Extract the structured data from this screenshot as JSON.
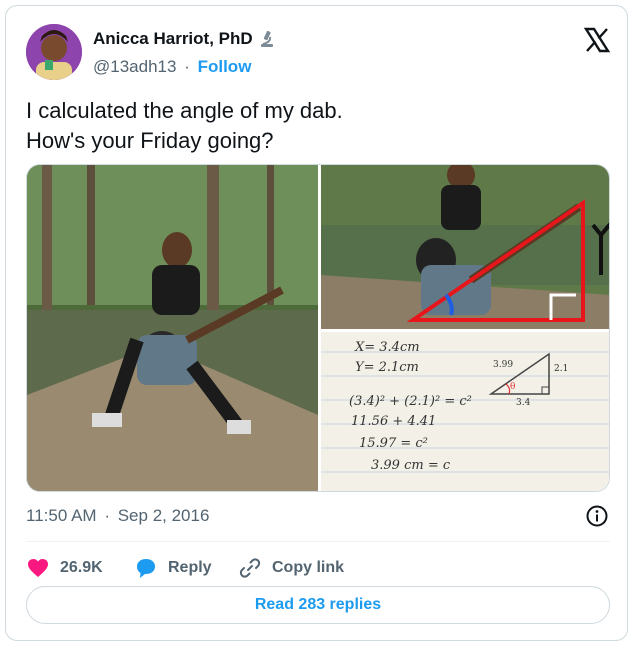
{
  "author": {
    "name": "Anicca Harriot, PhD",
    "handle": "@13adh13",
    "separator": "·",
    "follow_label": "Follow"
  },
  "tweet": {
    "line1": "I calculated the angle of my dab.",
    "line2": "How's your Friday going?"
  },
  "math_note": {
    "x_line": "X= 3.4cm",
    "y_line": "Y= 2.1cm",
    "eq1": "(3.4)² + (2.1)² = c²",
    "eq2": "11.56 + 4.41",
    "eq3": "15.97 = c²",
    "eq4": "3.99 cm = c",
    "tri_hyp": "3.99",
    "tri_side": "2.1",
    "tri_base": "3.4",
    "tri_angle": "θ"
  },
  "meta": {
    "time": "11:50 AM",
    "separator": "·",
    "date": "Sep 2, 2016"
  },
  "actions": {
    "likes": "26.9K",
    "reply": "Reply",
    "copy_link": "Copy link"
  },
  "read_replies": "Read 283 replies",
  "colors": {
    "accent": "#1d9bf0",
    "like": "#f91880",
    "reply": "#1d9bf0",
    "muted": "#536471"
  },
  "icons": [
    "microscope-icon",
    "x-logo-icon",
    "info-icon",
    "heart-icon",
    "reply-bubble-icon",
    "link-icon"
  ]
}
